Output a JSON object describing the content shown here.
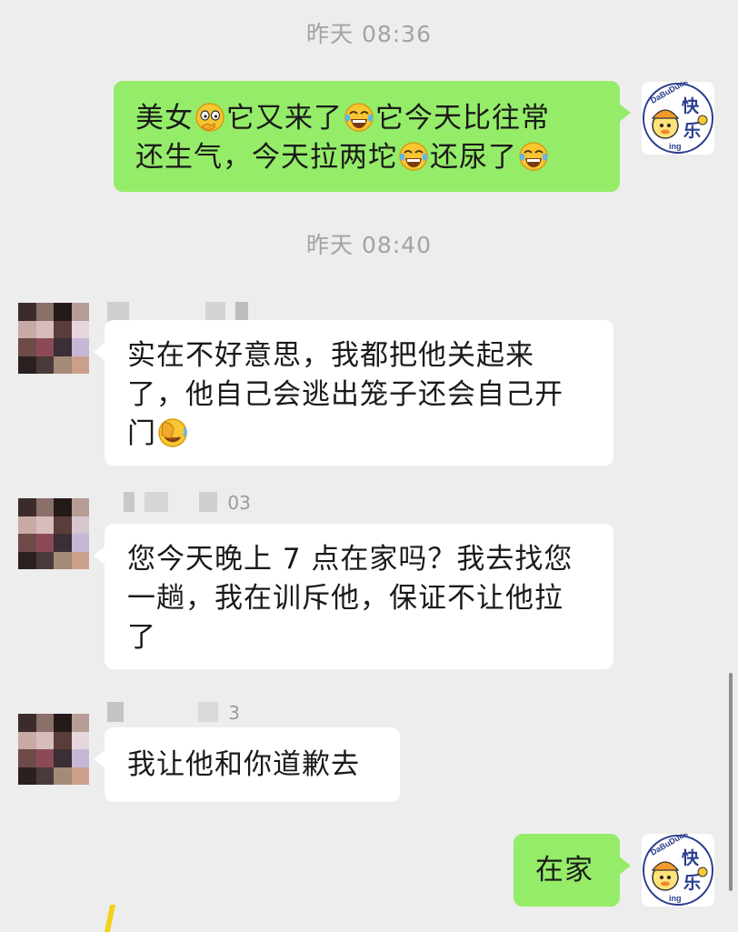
{
  "timestamps": [
    "昨天 08:36",
    "昨天 08:40"
  ],
  "messages": [
    {
      "sender": "me",
      "line1": [
        "美女",
        "它又来了",
        "它今天比往常"
      ],
      "line2": [
        "还生气，今天拉两坨",
        "还尿了",
        ""
      ],
      "emojis": [
        "thinking-face-emoji",
        "tears-of-joy-emoji",
        "tears-of-joy-emoji",
        "tears-of-joy-emoji"
      ]
    },
    {
      "sender": "other",
      "lines": [
        "实在不好意思，我都把他关起来",
        "了，他自己会逃出笼子还会自己开",
        "门"
      ],
      "emojis": [
        "facepalm-emoji"
      ]
    },
    {
      "sender": "other",
      "nickname_suffix": "03",
      "lines": [
        "您今天晚上 7 点在家吗？我去找您",
        "一趟，我在训斥他，保证不让他拉",
        "了"
      ]
    },
    {
      "sender": "other",
      "nickname_suffix": "3",
      "lines": [
        "我让他和你道歉去"
      ]
    },
    {
      "sender": "me",
      "lines": [
        "在家"
      ]
    }
  ],
  "my_avatar": {
    "text_top": "快",
    "text_bottom": "乐",
    "brand": "DaBuDuck",
    "tail": "ing",
    "icon": "duck-avatar"
  },
  "colors": {
    "background": "#ededed",
    "my_bubble": "#95ec69",
    "other_bubble": "#ffffff",
    "timestamp": "#a3a3a3"
  }
}
